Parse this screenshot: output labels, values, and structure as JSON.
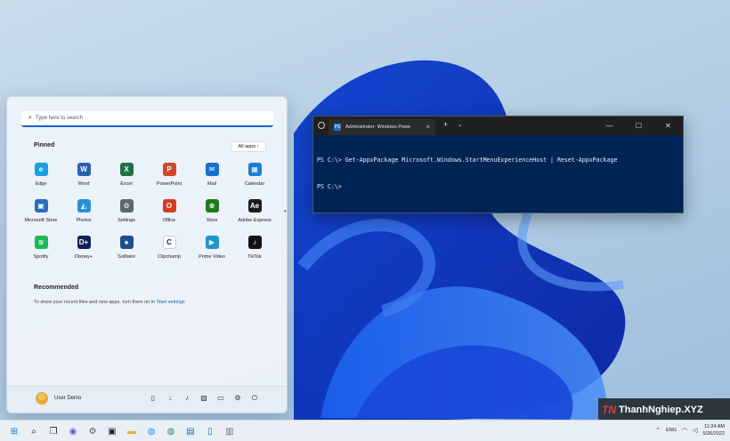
{
  "start_menu": {
    "search_placeholder": "Type here to search",
    "pinned_title": "Pinned",
    "all_apps_label": "All apps ›",
    "pinned_apps": [
      {
        "label": "Edge",
        "icon": "edge-icon",
        "color": "#1b9de2",
        "glyph": "e"
      },
      {
        "label": "Word",
        "icon": "word-icon",
        "color": "#2b5fb4",
        "glyph": "W"
      },
      {
        "label": "Excel",
        "icon": "excel-icon",
        "color": "#1d7245",
        "glyph": "X"
      },
      {
        "label": "PowerPoint",
        "icon": "powerpoint-icon",
        "color": "#d0472a",
        "glyph": "P"
      },
      {
        "label": "Mail",
        "icon": "mail-icon",
        "color": "#1570c9",
        "glyph": "✉"
      },
      {
        "label": "Calendar",
        "icon": "calendar-icon",
        "color": "#1a7ed6",
        "glyph": "▦"
      },
      {
        "label": "Microsoft Store",
        "icon": "store-icon",
        "color": "#2a6db8",
        "glyph": "▣"
      },
      {
        "label": "Photos",
        "icon": "photos-icon",
        "color": "#2b8fd8",
        "glyph": "◭"
      },
      {
        "label": "Settings",
        "icon": "settings-icon",
        "color": "#5b6673",
        "glyph": "⚙"
      },
      {
        "label": "Office",
        "icon": "office-icon",
        "color": "#d63b1f",
        "glyph": "O"
      },
      {
        "label": "Xbox",
        "icon": "xbox-icon",
        "color": "#1d7a1d",
        "glyph": "⊗"
      },
      {
        "label": "Adobe Express",
        "icon": "adobe-express-icon",
        "color": "#1a1a1a",
        "glyph": "Ae"
      },
      {
        "label": "Spotify",
        "icon": "spotify-icon",
        "color": "#1db954",
        "glyph": "≋"
      },
      {
        "label": "Disney+",
        "icon": "disney-plus-icon",
        "color": "#0f2059",
        "glyph": "D+"
      },
      {
        "label": "Solitaire",
        "icon": "solitaire-icon",
        "color": "#1f4f8a",
        "glyph": "♠"
      },
      {
        "label": "Clipchamp",
        "icon": "clipchamp-icon",
        "color": "#ffffff",
        "glyph": "C"
      },
      {
        "label": "Prime Video",
        "icon": "prime-video-icon",
        "color": "#1f97c9",
        "glyph": "▶"
      },
      {
        "label": "TikTok",
        "icon": "tiktok-icon",
        "color": "#111111",
        "glyph": "♪"
      }
    ],
    "recommended_title": "Recommended",
    "recommended_text": "To show your recent files and new apps, turn them on in ",
    "recommended_link": "Start settings",
    "user_name": "User Demo",
    "footer_icons": [
      "document-icon",
      "download-icon",
      "music-icon",
      "pictures-icon",
      "folder-icon",
      "settings-icon",
      "power-icon"
    ]
  },
  "terminal": {
    "tab_title": "Administrator: Windows Powe",
    "tab_badge": "PS",
    "lines": [
      "PS C:\\> Get-AppxPackage Microsoft.Windows.StartMenuExperienceHost | Reset-AppxPackage",
      "PS C:\\>"
    ],
    "controls": {
      "minimize": "—",
      "maximize": "☐",
      "close": "✕"
    },
    "new_tab": "+",
    "dropdown": "⌄"
  },
  "watermark": {
    "logo": "TN",
    "text": "ThanhNghiep.XYZ"
  },
  "taskbar": {
    "icons": [
      {
        "name": "start-icon",
        "glyph": "⊞",
        "color": "#1a73d6"
      },
      {
        "name": "search-icon",
        "glyph": "⌕",
        "color": "#222"
      },
      {
        "name": "task-view-icon",
        "glyph": "❐",
        "color": "#222"
      },
      {
        "name": "chat-icon",
        "glyph": "◉",
        "color": "#6b5bd6"
      },
      {
        "name": "settings-icon",
        "glyph": "⚙",
        "color": "#555"
      },
      {
        "name": "terminal-icon",
        "glyph": "▣",
        "color": "#222"
      },
      {
        "name": "file-explorer-icon",
        "glyph": "▬",
        "color": "#e3b23c"
      },
      {
        "name": "edge-icon",
        "glyph": "◍",
        "color": "#1b9de2"
      },
      {
        "name": "edge-beta-icon",
        "glyph": "◍",
        "color": "#2a8f63"
      },
      {
        "name": "store-icon",
        "glyph": "▤",
        "color": "#2a6db8"
      },
      {
        "name": "phone-icon",
        "glyph": "▯",
        "color": "#1a73d6"
      },
      {
        "name": "monitor-icon",
        "glyph": "▥",
        "color": "#777"
      }
    ],
    "tray": {
      "chevron": "⌃",
      "language": "ENG",
      "time": "11:24 AM",
      "date": "5/26/2022"
    }
  }
}
